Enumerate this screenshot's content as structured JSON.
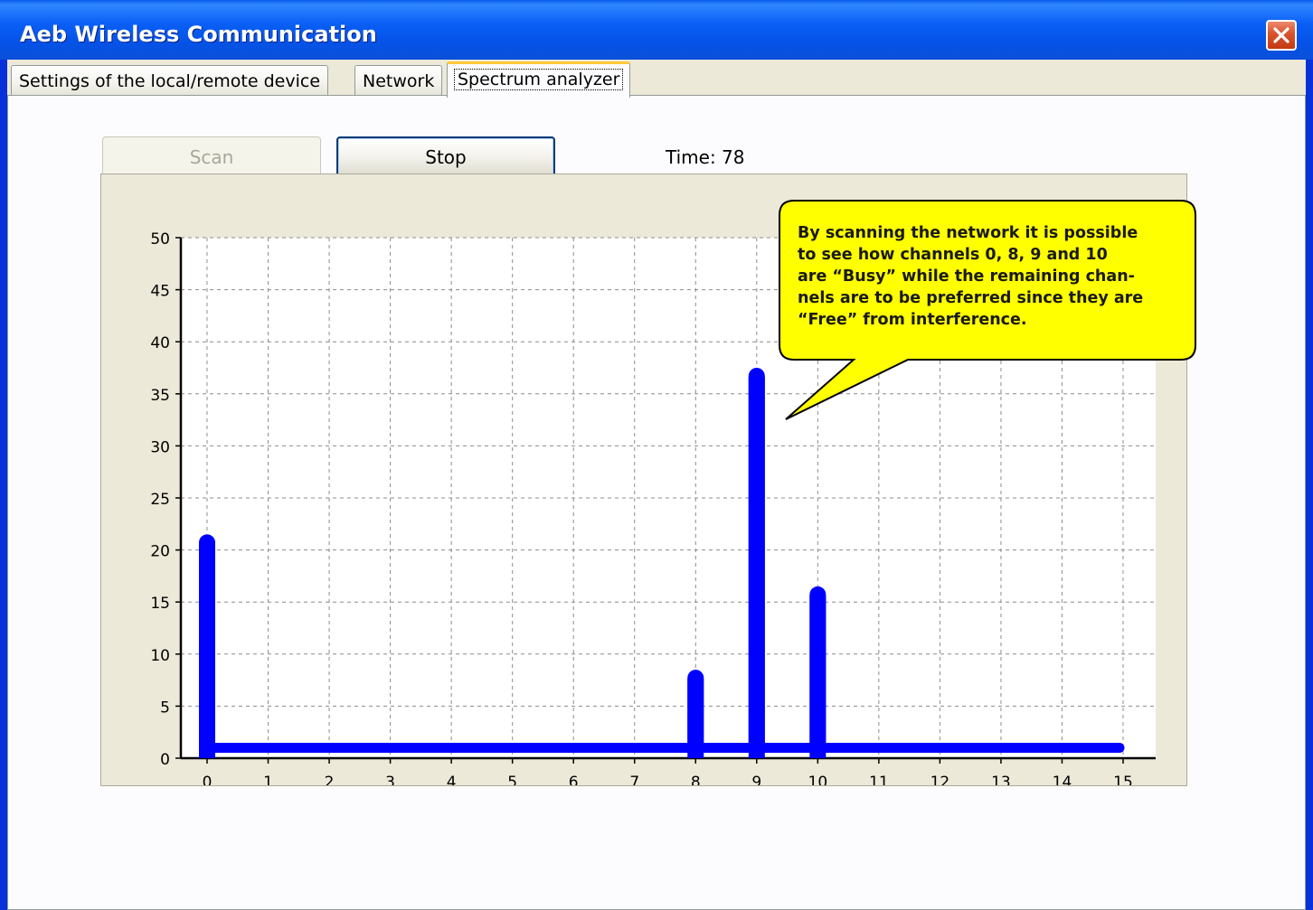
{
  "window": {
    "title": "Aeb Wireless Communication",
    "close_icon": "close-icon"
  },
  "tabs": [
    {
      "label": "Settings of the local/remote device",
      "active": false
    },
    {
      "label": "Network",
      "active": false
    },
    {
      "label": "Spectrum analyzer",
      "active": true
    }
  ],
  "toolbar": {
    "scan_label": "Scan",
    "scan_enabled": false,
    "stop_label": "Stop",
    "time_label": "Time: 78"
  },
  "callout": {
    "lines": [
      "By scanning the network it is possible",
      "to see how channels 0, 8, 9 and 10",
      "are “Busy” while the remaining chan-",
      "nels are to be preferred since they are",
      "“Free” from interference."
    ],
    "fill_color": "#ffff00",
    "stroke_color": "#000000"
  },
  "chart_data": {
    "type": "bar",
    "categories": [
      "0",
      "1",
      "2",
      "3",
      "4",
      "5",
      "6",
      "7",
      "8",
      "9",
      "10",
      "11",
      "12",
      "13",
      "14",
      "15"
    ],
    "values": [
      21.5,
      1,
      1,
      1,
      1,
      1,
      1,
      1,
      8.5,
      37.5,
      16.5,
      1,
      1,
      1,
      1,
      0
    ],
    "y_ticks": [
      "0",
      "5",
      "10",
      "15",
      "20",
      "25",
      "30",
      "35",
      "40",
      "45",
      "50"
    ],
    "ylim": [
      0,
      50
    ],
    "grid": true,
    "bar_color": "#0000ff",
    "plot_background": "#ffffff",
    "title": "",
    "xlabel": "",
    "ylabel": ""
  }
}
